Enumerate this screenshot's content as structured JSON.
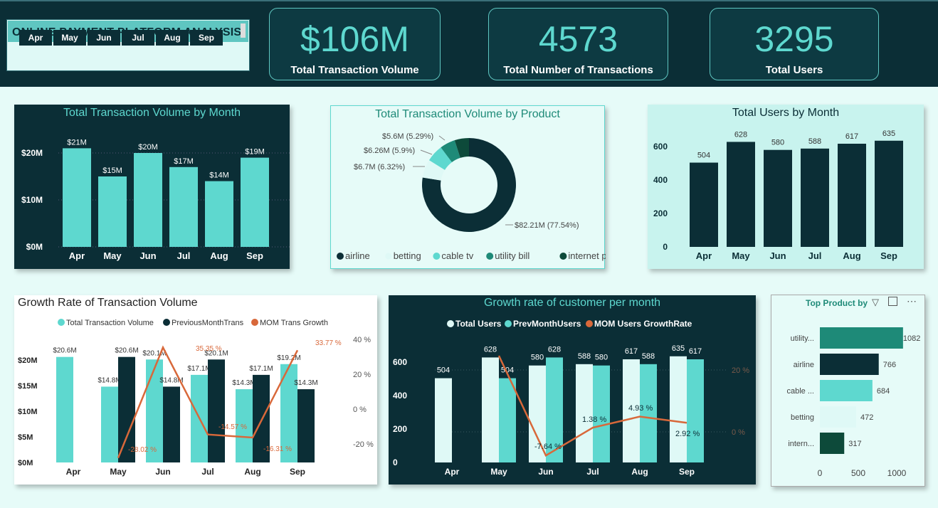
{
  "header": {
    "title": "ONLINE PAYMENT PLATFORM ANALYSIS",
    "months": [
      "Apr",
      "May",
      "Jun",
      "Jul",
      "Aug",
      "Sep"
    ]
  },
  "kpis": [
    {
      "value": "$106M",
      "label": "Total Transaction Volume"
    },
    {
      "value": "4573",
      "label": "Total Number of Transactions"
    },
    {
      "value": "3295",
      "label": "Total Users"
    }
  ],
  "colors": {
    "dark": "#0b2e36",
    "teal": "#5ed8cf",
    "mint": "#dff9f6",
    "orange": "#d8683a",
    "green": "#1e8a78"
  },
  "chart_data": [
    {
      "id": "tv_month",
      "type": "bar",
      "title": "Total Transaction Volume by Month",
      "categories": [
        "Apr",
        "May",
        "Jun",
        "Jul",
        "Aug",
        "Sep"
      ],
      "values": [
        21,
        15,
        20,
        17,
        14,
        19
      ],
      "data_labels": [
        "$21M",
        "$15M",
        "$20M",
        "$17M",
        "$14M",
        "$19M"
      ],
      "yticks": [
        "$0M",
        "$10M",
        "$20M"
      ],
      "ylim": [
        0,
        25
      ]
    },
    {
      "id": "tv_product",
      "type": "pie",
      "title": "Total Transaction Volume by Product",
      "slices": [
        {
          "name": "airline",
          "value": 82.21,
          "label": "$82.21M (77.54%)",
          "color": "#0b2e36"
        },
        {
          "name": "betting",
          "value": 6.7,
          "label": "$6.7M (6.32%)",
          "color": "#dff9f6"
        },
        {
          "name": "cable tv",
          "value": 6.26,
          "label": "$6.26M (5.9%)",
          "color": "#5ed8cf"
        },
        {
          "name": "utility bill",
          "value": 5.6,
          "label": "$5.6M (5.29%)",
          "color": "#1e8a78"
        },
        {
          "name": "internet provid...",
          "value": 5.26,
          "label": "",
          "color": "#0d4a3a"
        }
      ]
    },
    {
      "id": "users_month",
      "type": "bar",
      "title": "Total Users by Month",
      "categories": [
        "Apr",
        "May",
        "Jun",
        "Jul",
        "Aug",
        "Sep"
      ],
      "values": [
        504,
        628,
        580,
        588,
        617,
        635
      ],
      "yticks": [
        "0",
        "200",
        "400",
        "600"
      ],
      "ylim": [
        0,
        700
      ]
    },
    {
      "id": "growth_tv",
      "type": "bar",
      "title": "Growth Rate of Transaction Volume",
      "legend": [
        "Total Transaction Volume",
        "PreviousMonthTrans",
        "MOM Trans Growth"
      ],
      "categories": [
        "Apr",
        "May",
        "Jun",
        "Jul",
        "Aug",
        "Sep"
      ],
      "series": [
        {
          "name": "Total Transaction Volume",
          "values": [
            20.6,
            14.8,
            20.1,
            17.1,
            14.3,
            19.2
          ],
          "labels": [
            "$20.6M",
            "$14.8M",
            "$20.1M",
            "$17.1M",
            "$14.3M",
            "$19.2M"
          ]
        },
        {
          "name": "PreviousMonthTrans",
          "values": [
            null,
            20.6,
            14.8,
            20.1,
            17.1,
            14.3
          ],
          "labels": [
            "",
            "$20.6M",
            "$14.8M",
            "$20.1M",
            "$17.1M",
            "$14.3M"
          ]
        },
        {
          "name": "MOM Trans Growth",
          "values": [
            null,
            -28.02,
            35.35,
            -14.57,
            -16.31,
            33.77
          ],
          "labels": [
            "",
            "-28.02 %",
            "35.35 %",
            "-14.57 %",
            "-16.31 %",
            "33.77 %"
          ]
        }
      ],
      "yticks": [
        "$0M",
        "$5M",
        "$10M",
        "$15M",
        "$20M"
      ],
      "ylim": [
        0,
        25
      ],
      "y2ticks": [
        "-20 %",
        "0 %",
        "20 %",
        "40 %"
      ],
      "y2lim": [
        -30,
        40
      ]
    },
    {
      "id": "growth_users",
      "type": "bar",
      "title": "Growth rate of customer per month",
      "legend": [
        "Total Users",
        "PrevMonthUsers",
        "MOM Users GrowthRate"
      ],
      "categories": [
        "Apr",
        "May",
        "Jun",
        "Jul",
        "Aug",
        "Sep"
      ],
      "series": [
        {
          "name": "Total Users",
          "values": [
            504,
            628,
            580,
            588,
            617,
            635
          ]
        },
        {
          "name": "PrevMonthUsers",
          "values": [
            null,
            504,
            628,
            580,
            588,
            617
          ]
        },
        {
          "name": "MOM Users GrowthRate",
          "values": [
            null,
            24.6,
            -7.64,
            1.38,
            4.93,
            2.92
          ],
          "labels": [
            "",
            "",
            "-7.64 %",
            "1.38 %",
            "4.93 %",
            "2.92 %"
          ]
        }
      ],
      "yticks": [
        "0",
        "200",
        "400",
        "600"
      ],
      "ylim": [
        0,
        700
      ],
      "y2ticks": [
        "0 %",
        "20 %"
      ],
      "y2lim": [
        -15,
        35
      ]
    },
    {
      "id": "top_product",
      "type": "bar",
      "title": "Top Product by",
      "categories": [
        "utility...",
        "airline",
        "cable ...",
        "betting",
        "intern..."
      ],
      "values": [
        1082,
        766,
        684,
        472,
        317
      ],
      "colors": [
        "#1e8a78",
        "#0b2e36",
        "#5ed8cf",
        "#dff9f6",
        "#0d4a3a"
      ],
      "xticks": [
        "0",
        "500",
        "1000"
      ],
      "xlim": [
        0,
        1200
      ]
    }
  ]
}
